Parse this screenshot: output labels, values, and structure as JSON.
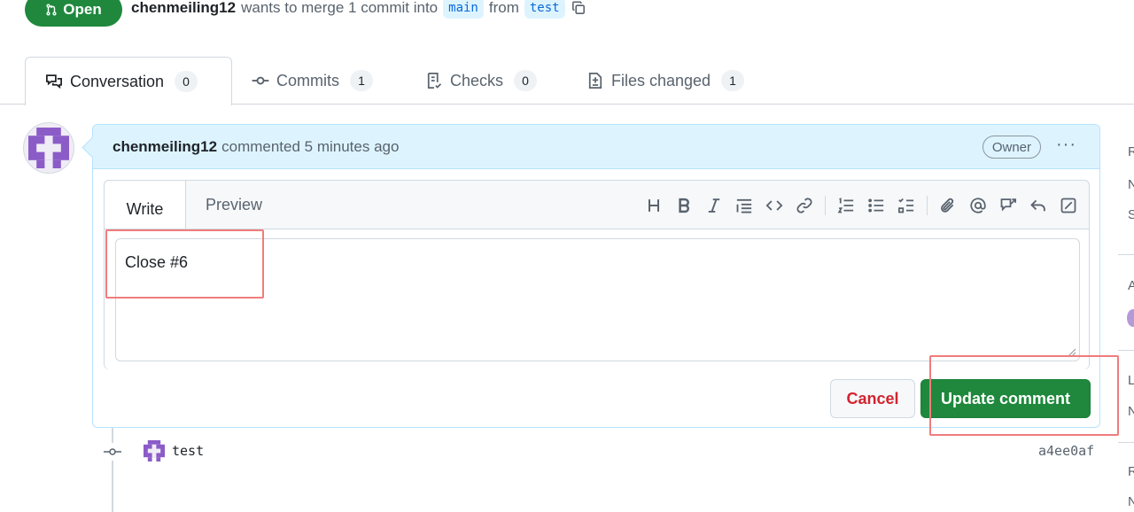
{
  "header": {
    "state_label": "Open",
    "author": "chenmeiling12",
    "merge_text": "wants to merge 1 commit into",
    "base_branch": "main",
    "from_text": "from",
    "head_branch": "test"
  },
  "tabs": [
    {
      "label": "Conversation",
      "count": "0",
      "icon": "comment-discussion-icon"
    },
    {
      "label": "Commits",
      "count": "1",
      "icon": "git-commit-icon"
    },
    {
      "label": "Checks",
      "count": "0",
      "icon": "checklist-icon"
    },
    {
      "label": "Files changed",
      "count": "1",
      "icon": "file-diff-icon"
    }
  ],
  "comment": {
    "author": "chenmeiling12",
    "action": "commented 5 minutes ago",
    "badge": "Owner",
    "menu": "···",
    "editor": {
      "write_tab": "Write",
      "preview_tab": "Preview",
      "toolbar": [
        "heading",
        "bold",
        "italic",
        "quote",
        "code",
        "link",
        "ordered-list",
        "unordered-list",
        "task-list",
        "attach",
        "mention",
        "cross-reference",
        "saved-replies",
        "fullscreen"
      ],
      "text": "Close #6"
    },
    "buttons": {
      "cancel": "Cancel",
      "update": "Update comment"
    }
  },
  "timeline": {
    "commit_message": "test",
    "commit_sha": "a4ee0af"
  },
  "sidebar_fragments": [
    "R",
    "N",
    "S",
    "A",
    "L",
    "N",
    "R",
    "N"
  ],
  "colors": {
    "open_green": "#1f883d",
    "comment_header_bg": "#ddf4ff",
    "comment_border": "#b6e3ff",
    "cancel_red": "#d1242f",
    "highlight": "#f07c7c",
    "avatar_purple": "#8b5cc7"
  }
}
